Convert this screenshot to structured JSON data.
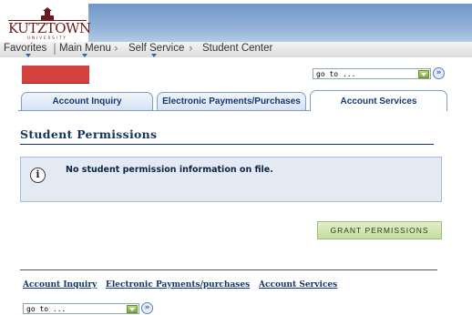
{
  "header": {
    "logo_text": "KUTZTOWN",
    "logo_sub": "UNIVERSITY"
  },
  "nav": {
    "items": [
      "Favorites",
      "Main Menu",
      "Self Service",
      "Student Center"
    ],
    "separator": "›"
  },
  "goto": {
    "top_value": "go to ...",
    "bottom_value": "go to ...",
    "go_symbol": "»"
  },
  "tabs": [
    {
      "label": "Account Inquiry",
      "active": false
    },
    {
      "label": "Electronic Payments/Purchases",
      "active": false
    },
    {
      "label": "Account Services",
      "active": true
    }
  ],
  "page": {
    "title": "Student Permissions",
    "info_icon": "i",
    "info_message": "No student permission information on file.",
    "grant_button": "GRANT PERMISSIONS"
  },
  "footer_links": [
    "Account Inquiry",
    "Electronic Payments/purchases",
    "Account Services"
  ],
  "colors": {
    "header_band": "#94b3d9",
    "tab_text": "#123a70",
    "info_bg": "#e3eaf3",
    "grant_bg": "#c5dca0",
    "redacted": "#d2413e"
  }
}
